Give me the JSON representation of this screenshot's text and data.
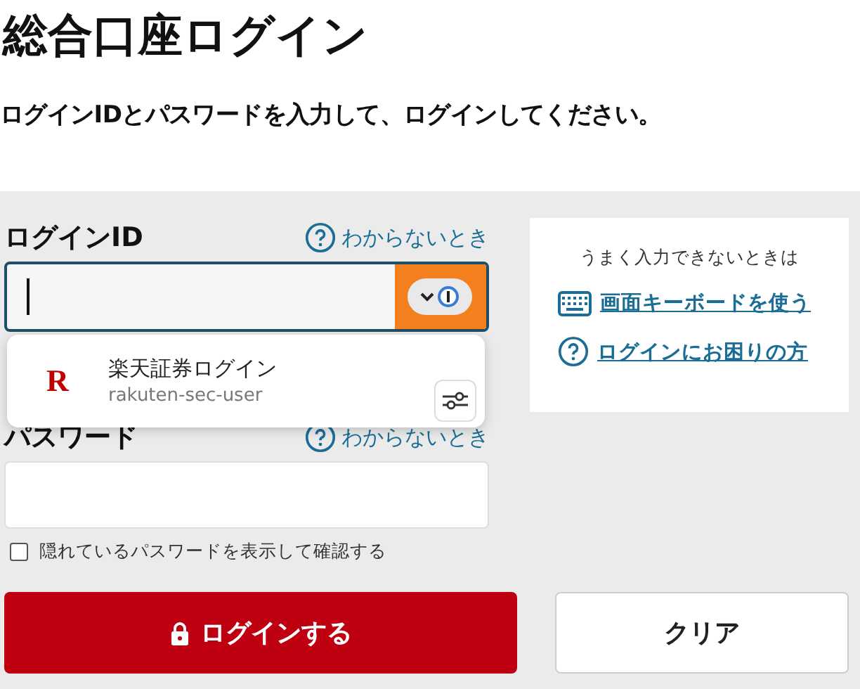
{
  "title": "総合口座ログイン",
  "instruction": "ログインIDとパスワードを入力して、ログインしてください。",
  "login_id": {
    "label": "ログインID",
    "help_link": "わからないとき",
    "focused": true
  },
  "autofill_popup": {
    "title": "楽天証券ログイン",
    "username": "rakuten-sec-user",
    "logo_letter": "R"
  },
  "password": {
    "label": "パスワード",
    "help_link": "わからないとき"
  },
  "show_password": {
    "label": "隠れているパスワードを表示して確認する",
    "checked": false
  },
  "buttons": [
    {
      "kind": "primary",
      "label": "ログインする"
    },
    {
      "kind": "secondary",
      "label": "クリア"
    }
  ],
  "help_card": {
    "heading": "うまく入力できないときは",
    "links": [
      {
        "kind": "keyboard",
        "label": "画面キーボードを使う"
      },
      {
        "kind": "help",
        "label": "ログインにお困りの方"
      }
    ]
  }
}
